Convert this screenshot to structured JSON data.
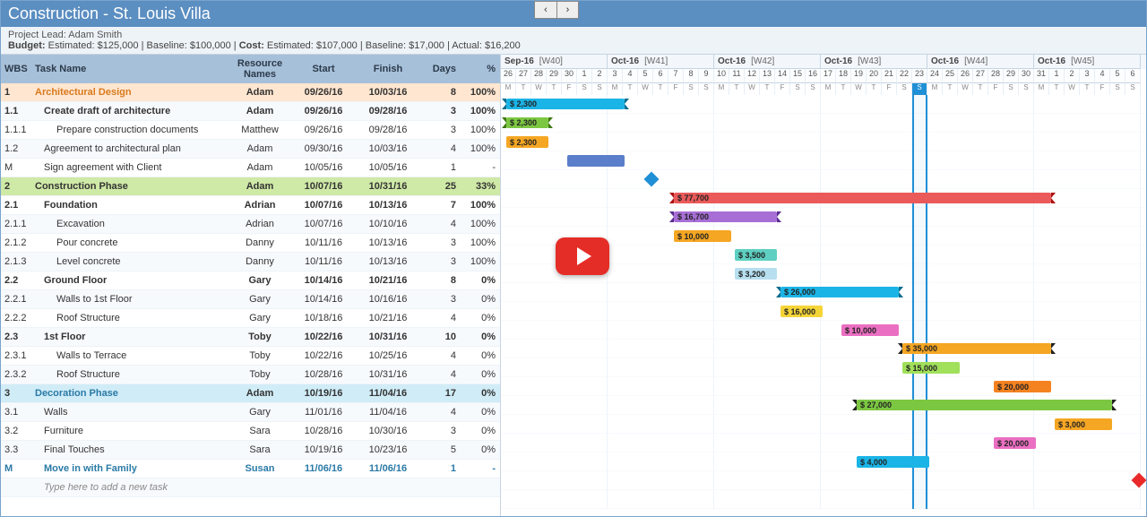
{
  "title": "Construction - St. Louis Villa",
  "meta": {
    "lead_label": "Project Lead:",
    "lead_value": "Adam Smith",
    "budget_label": "Budget:",
    "budget_est_label": "Estimated:",
    "budget_est": "$125,000",
    "budget_base_label": "Baseline:",
    "budget_base": "$100,000",
    "cost_label": "Cost:",
    "cost_est_label": "Estimated:",
    "cost_est": "$107,000",
    "cost_base_label": "Baseline:",
    "cost_base": "$17,000",
    "cost_act_label": "Actual:",
    "cost_act": "$16,200"
  },
  "cols": {
    "wbs": "WBS",
    "task": "Task Name",
    "res": "Resource Names",
    "start": "Start",
    "finish": "Finish",
    "days": "Days",
    "pct": "%"
  },
  "rows": [
    {
      "cls": "phase arch",
      "wbs": "1",
      "task": "Architectural Design",
      "ind": 0,
      "res": "Adam",
      "start": "09/26/16",
      "fin": "10/03/16",
      "days": "8",
      "pct": "100%"
    },
    {
      "cls": "subbold",
      "wbs": "1.1",
      "task": "Create draft of architecture",
      "ind": 1,
      "res": "Adam",
      "start": "09/26/16",
      "fin": "09/28/16",
      "days": "3",
      "pct": "100%"
    },
    {
      "cls": "",
      "wbs": "1.1.1",
      "task": "Prepare construction documents",
      "ind": 2,
      "res": "Matthew",
      "start": "09/26/16",
      "fin": "09/28/16",
      "days": "3",
      "pct": "100%"
    },
    {
      "cls": "",
      "wbs": "1.2",
      "task": "Agreement to architectural plan",
      "ind": 1,
      "res": "Adam",
      "start": "09/30/16",
      "fin": "10/03/16",
      "days": "4",
      "pct": "100%"
    },
    {
      "cls": "",
      "wbs": "M",
      "task": "Sign agreement with Client",
      "ind": 1,
      "res": "Adam",
      "start": "10/05/16",
      "fin": "10/05/16",
      "days": "1",
      "pct": "-"
    },
    {
      "cls": "phase constr",
      "wbs": "2",
      "task": "Construction Phase",
      "ind": 0,
      "res": "Adam",
      "start": "10/07/16",
      "fin": "10/31/16",
      "days": "25",
      "pct": "33%"
    },
    {
      "cls": "subbold",
      "wbs": "2.1",
      "task": "Foundation",
      "ind": 1,
      "res": "Adrian",
      "start": "10/07/16",
      "fin": "10/13/16",
      "days": "7",
      "pct": "100%"
    },
    {
      "cls": "",
      "wbs": "2.1.1",
      "task": "Excavation",
      "ind": 2,
      "res": "Adrian",
      "start": "10/07/16",
      "fin": "10/10/16",
      "days": "4",
      "pct": "100%"
    },
    {
      "cls": "",
      "wbs": "2.1.2",
      "task": "Pour concrete",
      "ind": 2,
      "res": "Danny",
      "start": "10/11/16",
      "fin": "10/13/16",
      "days": "3",
      "pct": "100%"
    },
    {
      "cls": "",
      "wbs": "2.1.3",
      "task": "Level concrete",
      "ind": 2,
      "res": "Danny",
      "start": "10/11/16",
      "fin": "10/13/16",
      "days": "3",
      "pct": "100%"
    },
    {
      "cls": "subbold",
      "wbs": "2.2",
      "task": "Ground Floor",
      "ind": 1,
      "res": "Gary",
      "start": "10/14/16",
      "fin": "10/21/16",
      "days": "8",
      "pct": "0%"
    },
    {
      "cls": "",
      "wbs": "2.2.1",
      "task": "Walls to 1st Floor",
      "ind": 2,
      "res": "Gary",
      "start": "10/14/16",
      "fin": "10/16/16",
      "days": "3",
      "pct": "0%"
    },
    {
      "cls": "",
      "wbs": "2.2.2",
      "task": "Roof Structure",
      "ind": 2,
      "res": "Gary",
      "start": "10/18/16",
      "fin": "10/21/16",
      "days": "4",
      "pct": "0%"
    },
    {
      "cls": "subbold",
      "wbs": "2.3",
      "task": "1st Floor",
      "ind": 1,
      "res": "Toby",
      "start": "10/22/16",
      "fin": "10/31/16",
      "days": "10",
      "pct": "0%"
    },
    {
      "cls": "",
      "wbs": "2.3.1",
      "task": "Walls to Terrace",
      "ind": 2,
      "res": "Toby",
      "start": "10/22/16",
      "fin": "10/25/16",
      "days": "4",
      "pct": "0%"
    },
    {
      "cls": "",
      "wbs": "2.3.2",
      "task": "Roof Structure",
      "ind": 2,
      "res": "Toby",
      "start": "10/28/16",
      "fin": "10/31/16",
      "days": "4",
      "pct": "0%"
    },
    {
      "cls": "phase decor",
      "wbs": "3",
      "task": "Decoration Phase",
      "ind": 0,
      "res": "Adam",
      "start": "10/19/16",
      "fin": "11/04/16",
      "days": "17",
      "pct": "0%"
    },
    {
      "cls": "",
      "wbs": "3.1",
      "task": "Walls",
      "ind": 1,
      "res": "Gary",
      "start": "11/01/16",
      "fin": "11/04/16",
      "days": "4",
      "pct": "0%"
    },
    {
      "cls": "",
      "wbs": "3.2",
      "task": "Furniture",
      "ind": 1,
      "res": "Sara",
      "start": "10/28/16",
      "fin": "10/30/16",
      "days": "3",
      "pct": "0%"
    },
    {
      "cls": "",
      "wbs": "3.3",
      "task": "Final Touches",
      "ind": 1,
      "res": "Sara",
      "start": "10/19/16",
      "fin": "10/23/16",
      "days": "5",
      "pct": "0%"
    },
    {
      "cls": "move",
      "wbs": "M",
      "task": "Move in with Family",
      "ind": 1,
      "res": "Susan",
      "start": "11/06/16",
      "fin": "11/06/16",
      "days": "1",
      "pct": "-"
    }
  ],
  "add_task_placeholder": "Type here to add a new task",
  "timeline": {
    "weeks": [
      {
        "m": "Sep-16",
        "w": "[W40]",
        "start": 0,
        "days": [
          "26",
          "27",
          "28",
          "29",
          "30",
          "1",
          "2"
        ]
      },
      {
        "m": "Oct-16",
        "w": "[W41]",
        "start": 7,
        "days": [
          "3",
          "4",
          "5",
          "6",
          "7",
          "8",
          "9"
        ]
      },
      {
        "m": "Oct-16",
        "w": "[W42]",
        "start": 14,
        "days": [
          "10",
          "11",
          "12",
          "13",
          "14",
          "15",
          "16"
        ]
      },
      {
        "m": "Oct-16",
        "w": "[W43]",
        "start": 21,
        "days": [
          "17",
          "18",
          "19",
          "20",
          "21",
          "22",
          "23"
        ]
      },
      {
        "m": "Oct-16",
        "w": "[W44]",
        "start": 28,
        "days": [
          "24",
          "25",
          "26",
          "27",
          "28",
          "29",
          "30"
        ]
      },
      {
        "m": "Oct-16",
        "w": "[W45]",
        "start": 35,
        "days": [
          "31",
          "1",
          "2",
          "3",
          "4",
          "5",
          "6"
        ]
      }
    ],
    "dow": [
      "M",
      "T",
      "W",
      "T",
      "F",
      "S",
      "S"
    ],
    "today_index": 27
  },
  "bars": [
    {
      "row": 0,
      "type": "sum",
      "cls": "c-blue",
      "text": "$ 2,300",
      "d0": 0,
      "d1": 8
    },
    {
      "row": 1,
      "type": "sum",
      "cls": "c-green",
      "text": "$ 2,300",
      "d0": 0,
      "d1": 3
    },
    {
      "row": 2,
      "type": "bar",
      "cls": "c-orange",
      "text": "$ 2,300",
      "d0": 0,
      "d1": 3
    },
    {
      "row": 3,
      "type": "bar",
      "cls": "c-midblue",
      "text": "",
      "d0": 4,
      "d1": 8
    },
    {
      "row": 4,
      "type": "ms",
      "cls": "ms-blue",
      "d0": 9.5
    },
    {
      "row": 5,
      "type": "sum",
      "cls": "c-red",
      "text": "$ 77,700",
      "d0": 11,
      "d1": 36
    },
    {
      "row": 6,
      "type": "sum",
      "cls": "c-purple",
      "text": "$ 16,700",
      "d0": 11,
      "d1": 18
    },
    {
      "row": 7,
      "type": "bar",
      "cls": "c-orange",
      "text": "$ 10,000",
      "d0": 11,
      "d1": 15
    },
    {
      "row": 8,
      "type": "bar",
      "cls": "c-teal",
      "text": "$ 3,500",
      "d0": 15,
      "d1": 18
    },
    {
      "row": 9,
      "type": "bar",
      "cls": "c-ltblue",
      "text": "$ 3,200",
      "d0": 15,
      "d1": 18
    },
    {
      "row": 10,
      "type": "sum",
      "cls": "c-blue",
      "text": "$ 26,000",
      "d0": 18,
      "d1": 26
    },
    {
      "row": 11,
      "type": "bar",
      "cls": "c-yellow",
      "text": "$ 16,000",
      "d0": 18,
      "d1": 21
    },
    {
      "row": 12,
      "type": "bar",
      "cls": "c-pink",
      "text": "$ 10,000",
      "d0": 22,
      "d1": 26
    },
    {
      "row": 13,
      "type": "sum",
      "cls": "c-orange",
      "text": "$ 35,000",
      "d0": 26,
      "d1": 36
    },
    {
      "row": 14,
      "type": "bar",
      "cls": "c-lime",
      "text": "$ 15,000",
      "d0": 26,
      "d1": 30
    },
    {
      "row": 15,
      "type": "bar",
      "cls": "c-orange2",
      "text": "$ 20,000",
      "d0": 32,
      "d1": 36
    },
    {
      "row": 16,
      "type": "sum",
      "cls": "c-green2",
      "text": "$ 27,000",
      "d0": 23,
      "d1": 40
    },
    {
      "row": 17,
      "type": "bar",
      "cls": "c-orange",
      "text": "$ 3,000",
      "d0": 36,
      "d1": 40
    },
    {
      "row": 18,
      "type": "bar",
      "cls": "c-pink",
      "text": "$ 20,000",
      "d0": 32,
      "d1": 35
    },
    {
      "row": 19,
      "type": "bar",
      "cls": "c-blue2",
      "text": "$ 4,000",
      "d0": 23,
      "d1": 28
    },
    {
      "row": 20,
      "type": "ms",
      "cls": "ms-red",
      "d0": 41.5
    }
  ],
  "chart_data": {
    "type": "gantt",
    "title": "Construction - St. Louis Villa",
    "timeline_start": "2016-09-26",
    "timeline_end": "2016-11-06",
    "today": "2016-10-23",
    "tasks": [
      {
        "wbs": "1",
        "name": "Architectural Design",
        "resource": "Adam",
        "start": "2016-09-26",
        "finish": "2016-10-03",
        "days": 8,
        "pct": 100,
        "cost": 2300,
        "summary": true
      },
      {
        "wbs": "1.1",
        "name": "Create draft of architecture",
        "resource": "Adam",
        "start": "2016-09-26",
        "finish": "2016-09-28",
        "days": 3,
        "pct": 100,
        "cost": 2300,
        "summary": true
      },
      {
        "wbs": "1.1.1",
        "name": "Prepare construction documents",
        "resource": "Matthew",
        "start": "2016-09-26",
        "finish": "2016-09-28",
        "days": 3,
        "pct": 100,
        "cost": 2300
      },
      {
        "wbs": "1.2",
        "name": "Agreement to architectural plan",
        "resource": "Adam",
        "start": "2016-09-30",
        "finish": "2016-10-03",
        "days": 4,
        "pct": 100
      },
      {
        "wbs": "M",
        "name": "Sign agreement with Client",
        "resource": "Adam",
        "start": "2016-10-05",
        "finish": "2016-10-05",
        "days": 1,
        "milestone": true
      },
      {
        "wbs": "2",
        "name": "Construction Phase",
        "resource": "Adam",
        "start": "2016-10-07",
        "finish": "2016-10-31",
        "days": 25,
        "pct": 33,
        "cost": 77700,
        "summary": true
      },
      {
        "wbs": "2.1",
        "name": "Foundation",
        "resource": "Adrian",
        "start": "2016-10-07",
        "finish": "2016-10-13",
        "days": 7,
        "pct": 100,
        "cost": 16700,
        "summary": true
      },
      {
        "wbs": "2.1.1",
        "name": "Excavation",
        "resource": "Adrian",
        "start": "2016-10-07",
        "finish": "2016-10-10",
        "days": 4,
        "pct": 100,
        "cost": 10000
      },
      {
        "wbs": "2.1.2",
        "name": "Pour concrete",
        "resource": "Danny",
        "start": "2016-10-11",
        "finish": "2016-10-13",
        "days": 3,
        "pct": 100,
        "cost": 3500
      },
      {
        "wbs": "2.1.3",
        "name": "Level concrete",
        "resource": "Danny",
        "start": "2016-10-11",
        "finish": "2016-10-13",
        "days": 3,
        "pct": 100,
        "cost": 3200
      },
      {
        "wbs": "2.2",
        "name": "Ground Floor",
        "resource": "Gary",
        "start": "2016-10-14",
        "finish": "2016-10-21",
        "days": 8,
        "pct": 0,
        "cost": 26000,
        "summary": true
      },
      {
        "wbs": "2.2.1",
        "name": "Walls to 1st Floor",
        "resource": "Gary",
        "start": "2016-10-14",
        "finish": "2016-10-16",
        "days": 3,
        "pct": 0,
        "cost": 16000
      },
      {
        "wbs": "2.2.2",
        "name": "Roof Structure",
        "resource": "Gary",
        "start": "2016-10-18",
        "finish": "2016-10-21",
        "days": 4,
        "pct": 0,
        "cost": 10000
      },
      {
        "wbs": "2.3",
        "name": "1st Floor",
        "resource": "Toby",
        "start": "2016-10-22",
        "finish": "2016-10-31",
        "days": 10,
        "pct": 0,
        "cost": 35000,
        "summary": true
      },
      {
        "wbs": "2.3.1",
        "name": "Walls to Terrace",
        "resource": "Toby",
        "start": "2016-10-22",
        "finish": "2016-10-25",
        "days": 4,
        "pct": 0,
        "cost": 15000
      },
      {
        "wbs": "2.3.2",
        "name": "Roof Structure",
        "resource": "Toby",
        "start": "2016-10-28",
        "finish": "2016-10-31",
        "days": 4,
        "pct": 0,
        "cost": 20000
      },
      {
        "wbs": "3",
        "name": "Decoration Phase",
        "resource": "Adam",
        "start": "2016-10-19",
        "finish": "2016-11-04",
        "days": 17,
        "pct": 0,
        "cost": 27000,
        "summary": true
      },
      {
        "wbs": "3.1",
        "name": "Walls",
        "resource": "Gary",
        "start": "2016-11-01",
        "finish": "2016-11-04",
        "days": 4,
        "pct": 0,
        "cost": 3000
      },
      {
        "wbs": "3.2",
        "name": "Furniture",
        "resource": "Sara",
        "start": "2016-10-28",
        "finish": "2016-10-30",
        "days": 3,
        "pct": 0,
        "cost": 20000
      },
      {
        "wbs": "3.3",
        "name": "Final Touches",
        "resource": "Sara",
        "start": "2016-10-19",
        "finish": "2016-10-23",
        "days": 5,
        "pct": 0,
        "cost": 4000
      },
      {
        "wbs": "M",
        "name": "Move in with Family",
        "resource": "Susan",
        "start": "2016-11-06",
        "finish": "2016-11-06",
        "days": 1,
        "milestone": true
      }
    ]
  }
}
